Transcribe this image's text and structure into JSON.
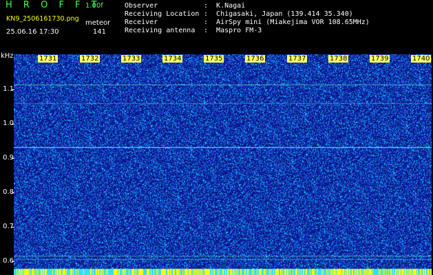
{
  "header": {
    "brand": "H R O F F T",
    "version": "1.00f",
    "file_name": "KN9_2506161730.png",
    "mode": "meteor",
    "datetime": "25.06.16 17:30",
    "count": "141",
    "info": [
      {
        "label": "Observer",
        "value": ":  K.Nagai"
      },
      {
        "label": "Receiving Location",
        "value": ":  Chigasaki, Japan (139.414 35.340)"
      },
      {
        "label": "Receiver",
        "value": ":  AirSpy mini (Miakejima VOR 108.65MHz)"
      },
      {
        "label": "Receiving antenna",
        "value": ":  Maspro FM-3"
      }
    ]
  },
  "axis": {
    "unit": "kHz",
    "y_ticks": [
      "1.1",
      "1.0",
      "0.9",
      "0.8",
      "0.7",
      "0.6"
    ],
    "x_ticks": [
      "1731",
      "1732",
      "1733",
      "1734",
      "1735",
      "1736",
      "1737",
      "1738",
      "1739",
      "1740"
    ]
  },
  "colors": {
    "background": "#0a1a9a",
    "noise_high": "#00e5ff",
    "noise_mid": "#3060ff",
    "tick_label_bg": "#ffff66",
    "bottom_band": "#ffff00"
  }
}
